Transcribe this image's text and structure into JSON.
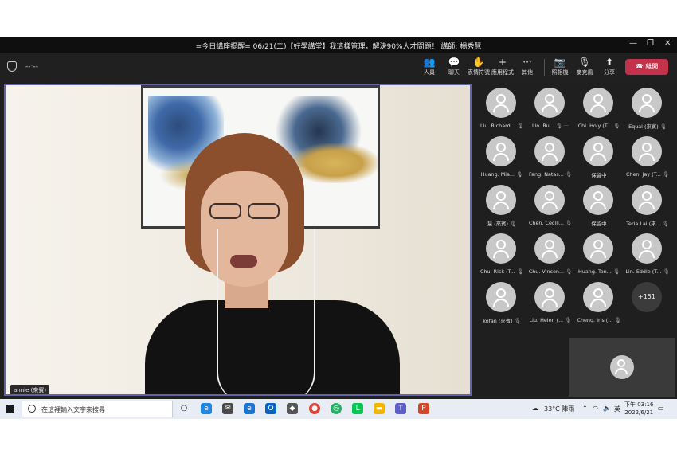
{
  "window": {
    "title": "=今日講座提醒= 06/21(二)【好學講堂】我這樣管理，解決90%人才問題！ 講師: 楊秀慧",
    "controls": [
      "—",
      "❐",
      "✕"
    ]
  },
  "toolbar": {
    "timer": "--:--",
    "buttons": [
      {
        "label": "人員",
        "icon": "people-icon",
        "glyph": "👥"
      },
      {
        "label": "聊天",
        "icon": "chat-icon",
        "glyph": "💬"
      },
      {
        "label": "表情符號",
        "icon": "reaction-icon",
        "glyph": "✋"
      },
      {
        "label": "應用程式",
        "icon": "apps-icon",
        "glyph": "+"
      },
      {
        "label": "其他",
        "icon": "more-icon",
        "glyph": "···"
      },
      {
        "label": "照相機",
        "icon": "camera-off-icon",
        "glyph": "📷"
      },
      {
        "label": "麥克風",
        "icon": "mic-off-icon",
        "glyph": "🎙"
      },
      {
        "label": "分享",
        "icon": "share-icon",
        "glyph": "⬆"
      }
    ],
    "leave_label": "離開"
  },
  "main_video": {
    "speaker_name": "annie (來賓)"
  },
  "participants": [
    {
      "name": "Liu. Richard...",
      "mic": "🎙"
    },
    {
      "name": "Lin. Ru...",
      "mic": "🎙 ···"
    },
    {
      "name": "Chi. Holy (T...",
      "mic": "🎙"
    },
    {
      "name": "Equal (來賓)",
      "mic": "🎙"
    },
    {
      "name": "Huang. Mia...",
      "mic": "🎙"
    },
    {
      "name": "Fang. Natas...",
      "mic": "🎙"
    },
    {
      "name": "保留中",
      "mic": ""
    },
    {
      "name": "Chen. Jay (T...",
      "mic": "🎙"
    },
    {
      "name": "慧 (來賓)",
      "mic": "🎙"
    },
    {
      "name": "Chen. Cecili...",
      "mic": "🎙"
    },
    {
      "name": "保留中",
      "mic": ""
    },
    {
      "name": "Teria Lai (來...",
      "mic": "🎙"
    },
    {
      "name": "Chu. Rick (T...",
      "mic": "🎙"
    },
    {
      "name": "Chu. Vincen...",
      "mic": "🎙"
    },
    {
      "name": "Huang. Ton...",
      "mic": "🎙"
    },
    {
      "name": "Lin. Eddie (T...",
      "mic": "🎙"
    },
    {
      "name": "kofan (來賓)",
      "mic": "🎙"
    },
    {
      "name": "Liu. Helen (...",
      "mic": "🎙"
    },
    {
      "name": "Cheng. Iris (...",
      "mic": "🎙"
    }
  ],
  "overflow_count": "+151",
  "taskbar": {
    "search_placeholder": "在這裡輸入文字來搜尋",
    "weather": "33°C 陣雨",
    "ime": "英",
    "time": "下午 03:16",
    "date": "2022/6/21"
  },
  "colors": {
    "accent": "#6264a7",
    "leave": "#c4314b",
    "app_bg": "#1f1f1f"
  }
}
